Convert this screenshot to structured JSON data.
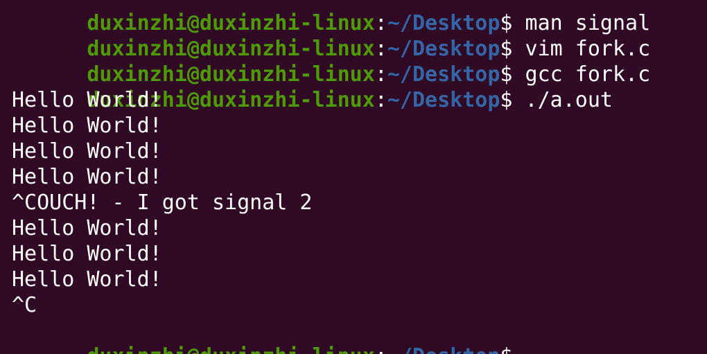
{
  "colors": {
    "background": "#300a24",
    "prompt_user": "#4e9a06",
    "prompt_path": "#3465a4",
    "text": "#ffffff"
  },
  "prompt": {
    "user_host": "duxinzhi@duxinzhi-linux",
    "colon": ":",
    "path": "~/Desktop",
    "dollar": "$"
  },
  "lines": [
    {
      "type": "prompt",
      "command": " man signal"
    },
    {
      "type": "prompt",
      "command": " vim fork.c"
    },
    {
      "type": "prompt",
      "command": " gcc fork.c"
    },
    {
      "type": "prompt",
      "command": " ./a.out"
    },
    {
      "type": "output",
      "text": "Hello World!"
    },
    {
      "type": "output",
      "text": "Hello World!"
    },
    {
      "type": "output",
      "text": "Hello World!"
    },
    {
      "type": "output",
      "text": "Hello World!"
    },
    {
      "type": "output",
      "text": "^COUCH! - I got signal 2"
    },
    {
      "type": "output",
      "text": "Hello World!"
    },
    {
      "type": "output",
      "text": "Hello World!"
    },
    {
      "type": "output",
      "text": "Hello World!"
    },
    {
      "type": "output",
      "text": "^C"
    },
    {
      "type": "prompt",
      "command": ""
    }
  ]
}
